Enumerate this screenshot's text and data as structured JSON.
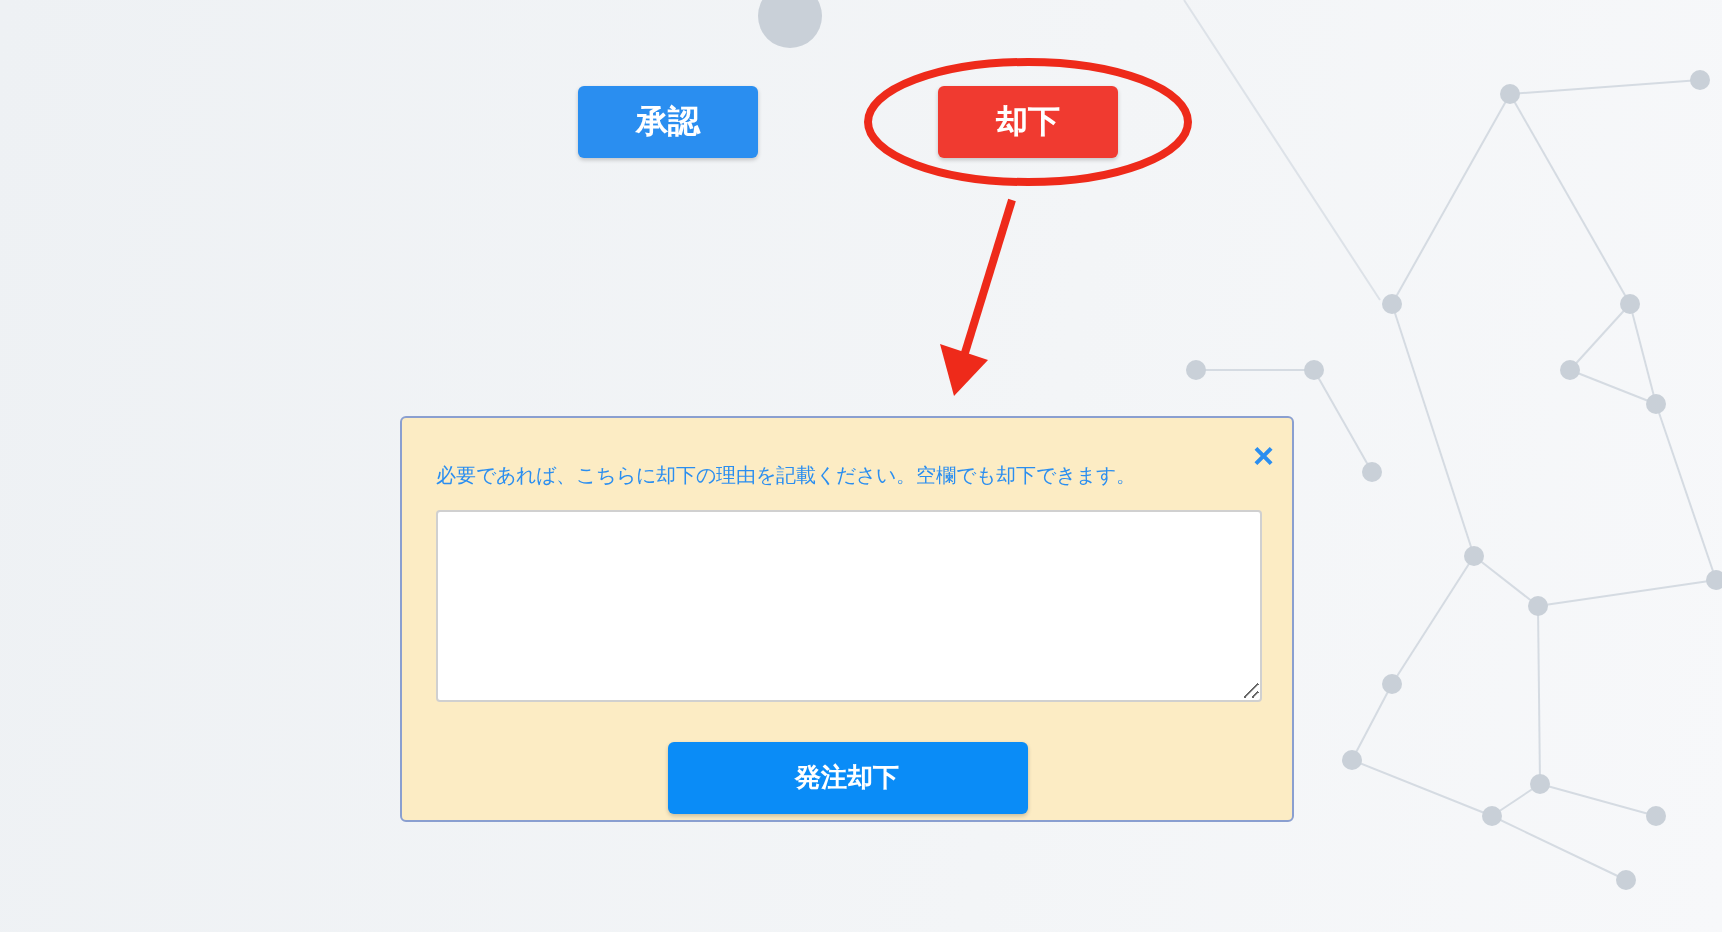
{
  "actions": [
    {
      "label": "承認",
      "kind": "approve"
    },
    {
      "label": "却下",
      "kind": "reject"
    }
  ],
  "dialog": {
    "message": "必要であれば、こちらに却下の理由を記載ください。空欄でも却下できます。",
    "close": "×",
    "submit": "発注却下"
  }
}
